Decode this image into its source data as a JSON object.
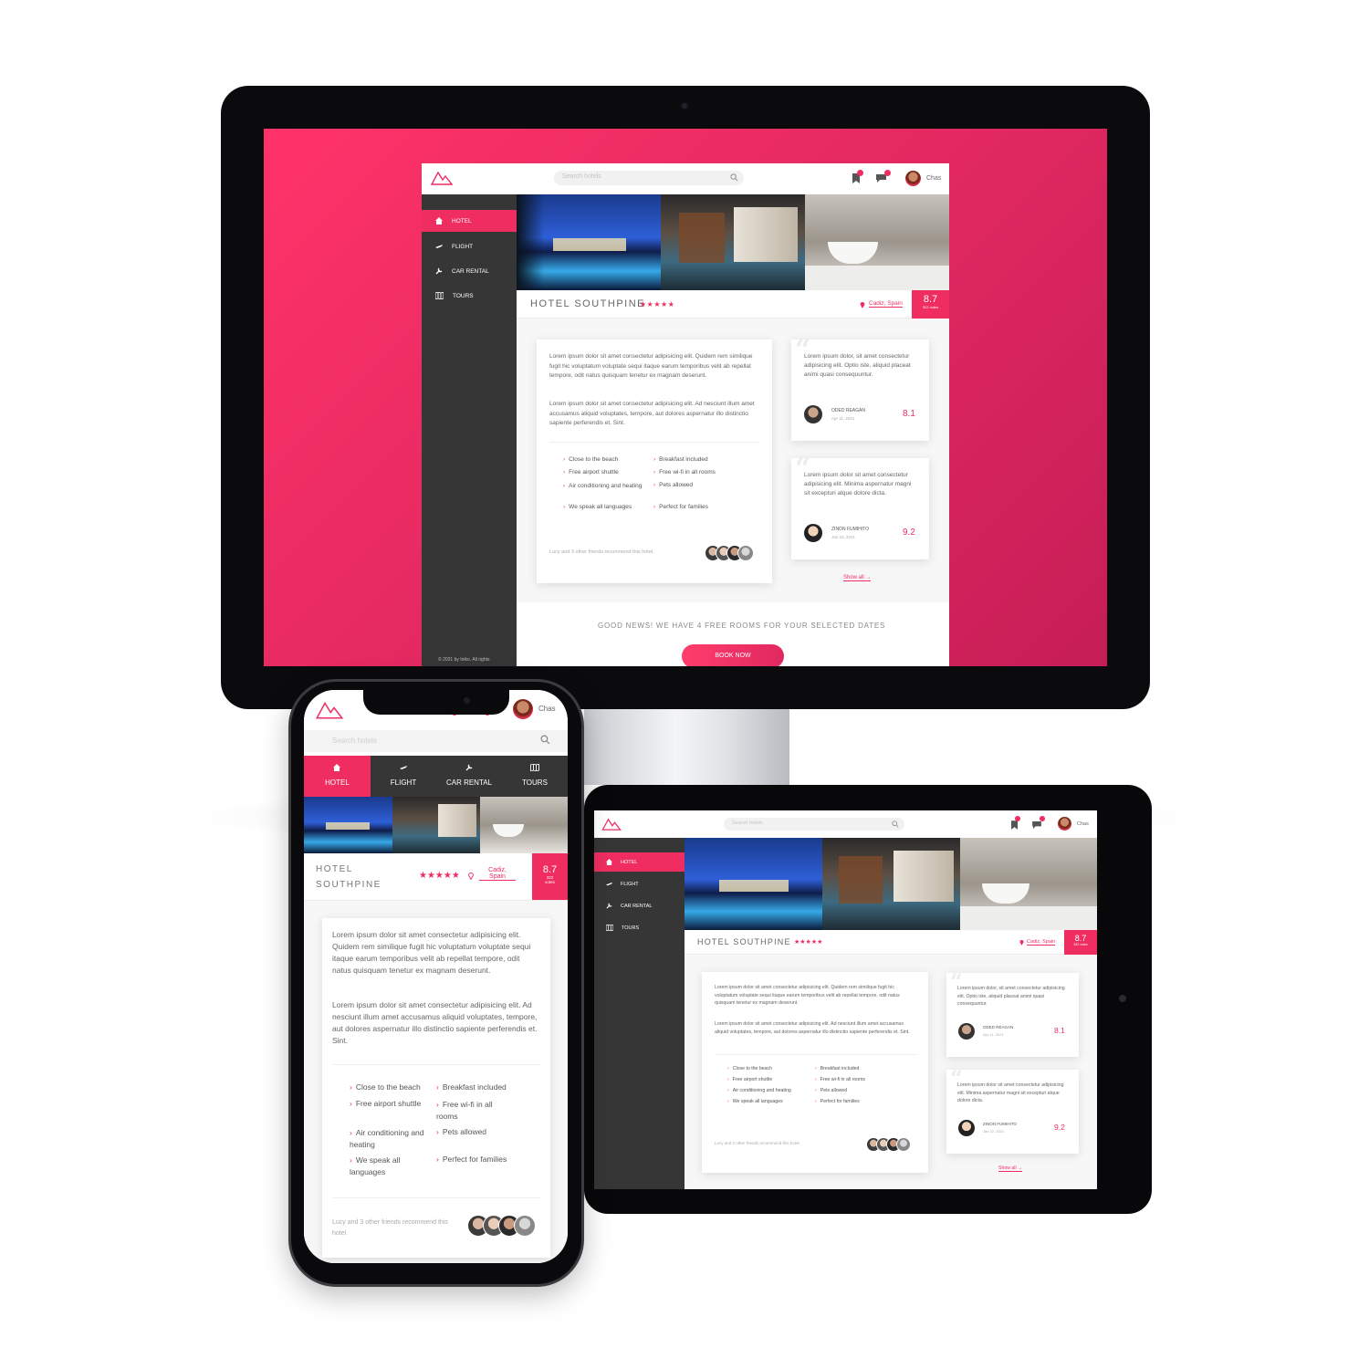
{
  "app": {
    "search_placeholder": "Search hotels",
    "user_name": "Chas",
    "nav": [
      {
        "label": "HOTEL",
        "icon": "home-icon"
      },
      {
        "label": "FLIGHT",
        "icon": "plane-icon"
      },
      {
        "label": "CAR RENTAL",
        "icon": "wrench-icon"
      },
      {
        "label": "TOURS",
        "icon": "map-icon"
      }
    ],
    "copyright": "© 2021 by Iniko. All rights",
    "hotel": {
      "name": "HOTEL SOUTHPINE",
      "name_line1": "HOTEL",
      "name_line2": "SOUTHPINE",
      "stars": "★★★★★",
      "location": "Cadiz, Spain",
      "location_line1": "Cadiz,",
      "location_line2": "Spain",
      "score": "8.7",
      "votes": "322 votes",
      "votes_short": "votes",
      "votes_count": "322"
    },
    "description": {
      "p1": "Lorem ipsum dolor sit amet consectetur adipisicing elit. Quidem rem similique fugit hic voluptatum voluptate sequi itaque earum temporibus velit ab repellat tempore, odit natus quisquam tenetur ex magnam deserunt.",
      "p2": "Lorem ipsum dolor sit amet consectetur adipisicing elit. Ad nesciunt illum amet accusamus aliquid voluptates, tempore, aut dolores aspernatur illo distinctio sapiente perferendis et. Sint."
    },
    "features": [
      "Close to the beach",
      "Breakfast included",
      "Free airport shuttle",
      "Free wi-fi in all rooms",
      "Air conditioning and heating",
      "Pets allowed",
      "We speak all languages",
      "Perfect for families"
    ],
    "recommend": "Lucy and 3 other friends recommend this hotel.",
    "reviews": [
      {
        "text": "Lorem ipsum dolor, sit amet consectetur adipisicing elit. Optio iste, aliquid placeat animi quasi consequuntur.",
        "name": "ODED REAGAN",
        "date": "Apr 11, 2021",
        "score": "8.1"
      },
      {
        "text": "Lorem ipsum dolor sit amet consectetur adipisicing elit. Minima aspernatur magni sit excepturi atque dolore dicta.",
        "name": "ZINON FUMIHITO",
        "date": "Jan 22, 2021",
        "score": "9.2"
      }
    ],
    "show_all": "Show all →",
    "good_news": "GOOD NEWS! WE HAVE 4 FREE ROOMS FOR YOUR SELECTED DATES",
    "book_now": "BOOK NOW",
    "notif_count": "1",
    "msg_count": "1"
  },
  "colors": {
    "accent": "#ef2d61",
    "sidebar": "#363636",
    "background_gradient_start": "#ff3369",
    "background_gradient_end": "#c61d57"
  }
}
